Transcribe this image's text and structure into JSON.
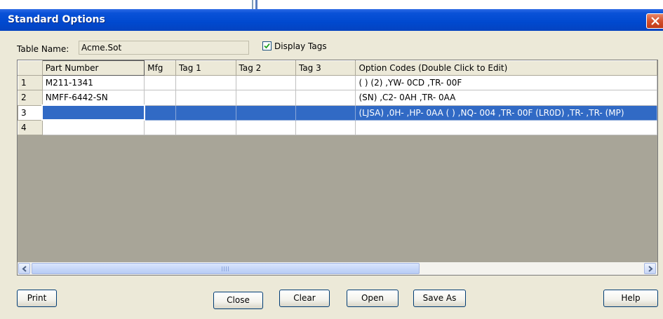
{
  "window": {
    "title": "Standard Options"
  },
  "form": {
    "table_name_label": "Table Name:",
    "table_name_value": "Acme.Sot",
    "display_tags_label": "Display Tags",
    "display_tags_checked": true
  },
  "grid": {
    "columns": [
      "",
      "Part Number",
      "Mfg",
      "Tag 1",
      "Tag 2",
      "Tag 3",
      "Option Codes (Double Click to Edit)"
    ],
    "rows": [
      {
        "num": "1",
        "part": "M211-1341",
        "mfg": "",
        "tag1": "",
        "tag2": "",
        "tag3": "",
        "codes": "( ) (2) ,YW- 0CD ,TR- 00F"
      },
      {
        "num": "2",
        "part": "NMFF-6442-SN",
        "mfg": "",
        "tag1": "",
        "tag2": "",
        "tag3": "",
        "codes": "(SN) ,C2- 0AH ,TR- 0AA"
      },
      {
        "num": "3",
        "part": "",
        "mfg": "",
        "tag1": "",
        "tag2": "",
        "tag3": "",
        "codes": "(LJSA) ,0H- ,HP- 0AA ( ) ,NQ- 004 ,TR- 00F (LR0D) ,TR- ,TR- (MP)"
      },
      {
        "num": "4",
        "part": "",
        "mfg": "",
        "tag1": "",
        "tag2": "",
        "tag3": "",
        "codes": ""
      }
    ],
    "selected_row": 3
  },
  "buttons": {
    "print": "Print",
    "close": "Close",
    "clear": "Clear",
    "open": "Open",
    "save_as": "Save As",
    "help": "Help"
  },
  "colors": {
    "titlebar": "#0a52d8",
    "selection": "#316ac5",
    "dialog_bg": "#ece9d8",
    "grid_empty_bg": "#a8a598"
  },
  "icons": {
    "close": "close-icon",
    "check": "checkmark-icon",
    "scroll_left": "arrow-left-icon",
    "scroll_right": "arrow-right-icon"
  }
}
